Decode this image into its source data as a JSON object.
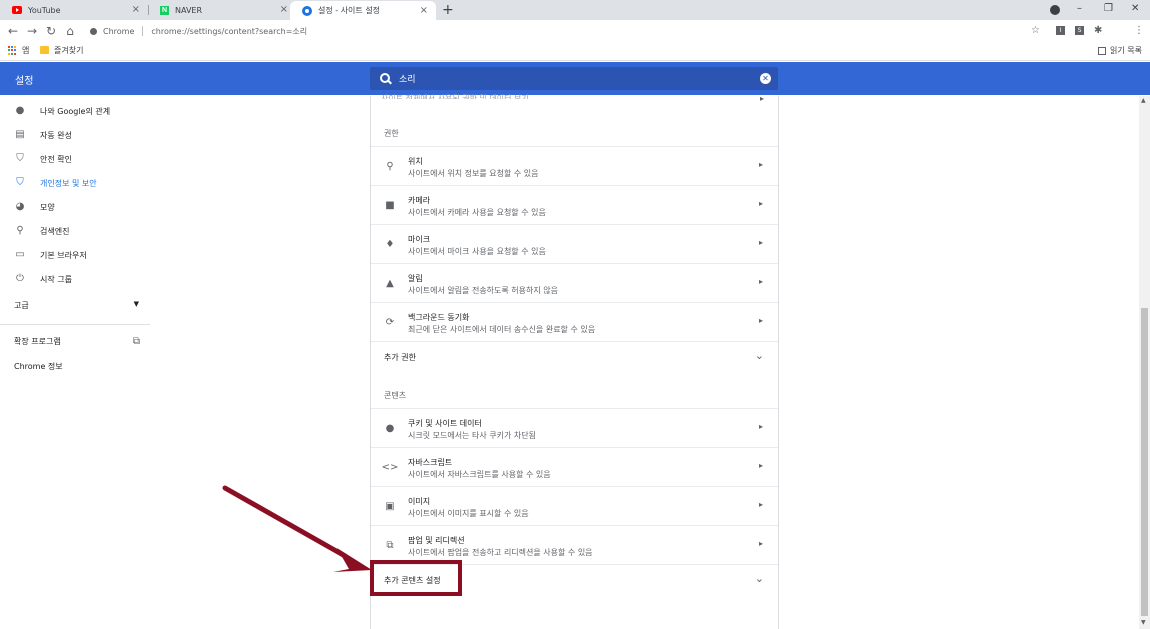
{
  "tabs": [
    {
      "title": "YouTube",
      "favicon": "youtube-icon"
    },
    {
      "title": "NAVER",
      "favicon": "naver-icon"
    },
    {
      "title": "설정 - 사이트 설정",
      "favicon": "settings-gear-icon",
      "active": true
    }
  ],
  "tab_close_glyph": "×",
  "new_tab_glyph": "+",
  "toolbar": {
    "scheme_label": "Chrome",
    "url": "chrome://settings/content?search=소리"
  },
  "extensions": [
    "I",
    "S"
  ],
  "bookmarks": {
    "apps_label": "앱",
    "folder_label": "즐겨찾기",
    "reading_list_label": "읽기 목록"
  },
  "header": {
    "title": "설정",
    "search_value": "소리"
  },
  "sidebar": {
    "items": [
      {
        "label": "나와 Google의 관계",
        "icon": "person-icon"
      },
      {
        "label": "자동 완성",
        "icon": "clipboard-icon"
      },
      {
        "label": "안전 확인",
        "icon": "shield-check-icon"
      },
      {
        "label": "개인정보 및 보안",
        "icon": "shield-icon",
        "selected": true
      },
      {
        "label": "모양",
        "icon": "palette-icon"
      },
      {
        "label": "검색엔진",
        "icon": "search-icon"
      },
      {
        "label": "기본 브라우저",
        "icon": "browser-icon"
      },
      {
        "label": "시작 그룹",
        "icon": "power-icon"
      }
    ],
    "advanced_label": "고급",
    "extensions_label": "확장 프로그램",
    "about_label": "Chrome 정보"
  },
  "main": {
    "permissions_label": "권한",
    "permissions": [
      {
        "title": "위치",
        "subtitle": "사이트에서 위치 정보를 요청할 수 있음",
        "icon": "location-pin-icon"
      },
      {
        "title": "카메라",
        "subtitle": "사이트에서 카메라 사용을 요청할 수 있음",
        "icon": "camera-icon"
      },
      {
        "title": "마이크",
        "subtitle": "사이트에서 마이크 사용을 요청할 수 있음",
        "icon": "microphone-icon"
      },
      {
        "title": "알림",
        "subtitle": "사이트에서 알림을 전송하도록 허용하지 않음",
        "icon": "bell-icon"
      },
      {
        "title": "백그라운드 동기화",
        "subtitle": "최근에 닫은 사이트에서 데이터 송수신을 완료할 수 있음",
        "icon": "sync-icon"
      }
    ],
    "more_permissions_label": "추가 권한",
    "content_label": "콘텐츠",
    "content": [
      {
        "title": "쿠키 및 사이트 데이터",
        "subtitle": "시크릿 모드에서는 타사 쿠키가 차단됨",
        "icon": "cookie-icon"
      },
      {
        "title": "자바스크립트",
        "subtitle": "사이트에서 자바스크립트를 사용할 수 있음",
        "icon": "code-icon"
      },
      {
        "title": "이미지",
        "subtitle": "사이트에서 이미지를 표시할 수 있음",
        "icon": "image-icon"
      },
      {
        "title": "팝업 및 리디렉션",
        "subtitle": "사이트에서 팝업을 전송하고 리디렉션을 사용할 수 있음",
        "icon": "open-in-new-icon"
      }
    ],
    "more_content_label": "추가 콘텐츠 설정"
  },
  "colors": {
    "header_blue": "#3367d6",
    "selected_blue": "#1a73e8",
    "annotation_red": "#8b0f22"
  }
}
